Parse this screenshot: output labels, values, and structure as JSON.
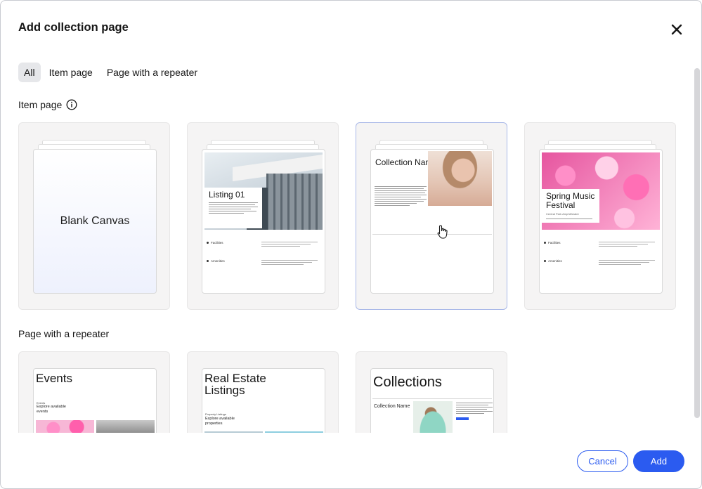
{
  "dialog": {
    "title": "Add collection page",
    "close_icon": "close-icon"
  },
  "filters": [
    {
      "label": "All",
      "active": true
    },
    {
      "label": "Item page",
      "active": false
    },
    {
      "label": "Page with a repeater",
      "active": false
    }
  ],
  "item_section": {
    "title": "Item page",
    "info_icon": "info-icon",
    "cards": [
      {
        "label": "Blank Canvas"
      },
      {
        "label": "Listing 01",
        "rows": [
          "Facilities",
          "Amenities"
        ]
      },
      {
        "label": "Collection Name"
      },
      {
        "label": "Spring Music Festival",
        "subtitle": "Central Park Amphitheater",
        "rows": [
          "Facilities",
          "Amenities"
        ]
      }
    ]
  },
  "repeater_section": {
    "title": "Page with a repeater",
    "cards": [
      {
        "label": "Events",
        "small": "Events",
        "sub": "Explore available events"
      },
      {
        "label": "Real Estate Listings",
        "small": "Property Listings",
        "sub": "Explore available properties"
      },
      {
        "label": "Collections",
        "item": "Collection Name"
      }
    ]
  },
  "footer": {
    "cancel_label": "Cancel",
    "add_label": "Add"
  },
  "colors": {
    "accent": "#2b5bf0",
    "selected_border": "#a9b8e8"
  }
}
